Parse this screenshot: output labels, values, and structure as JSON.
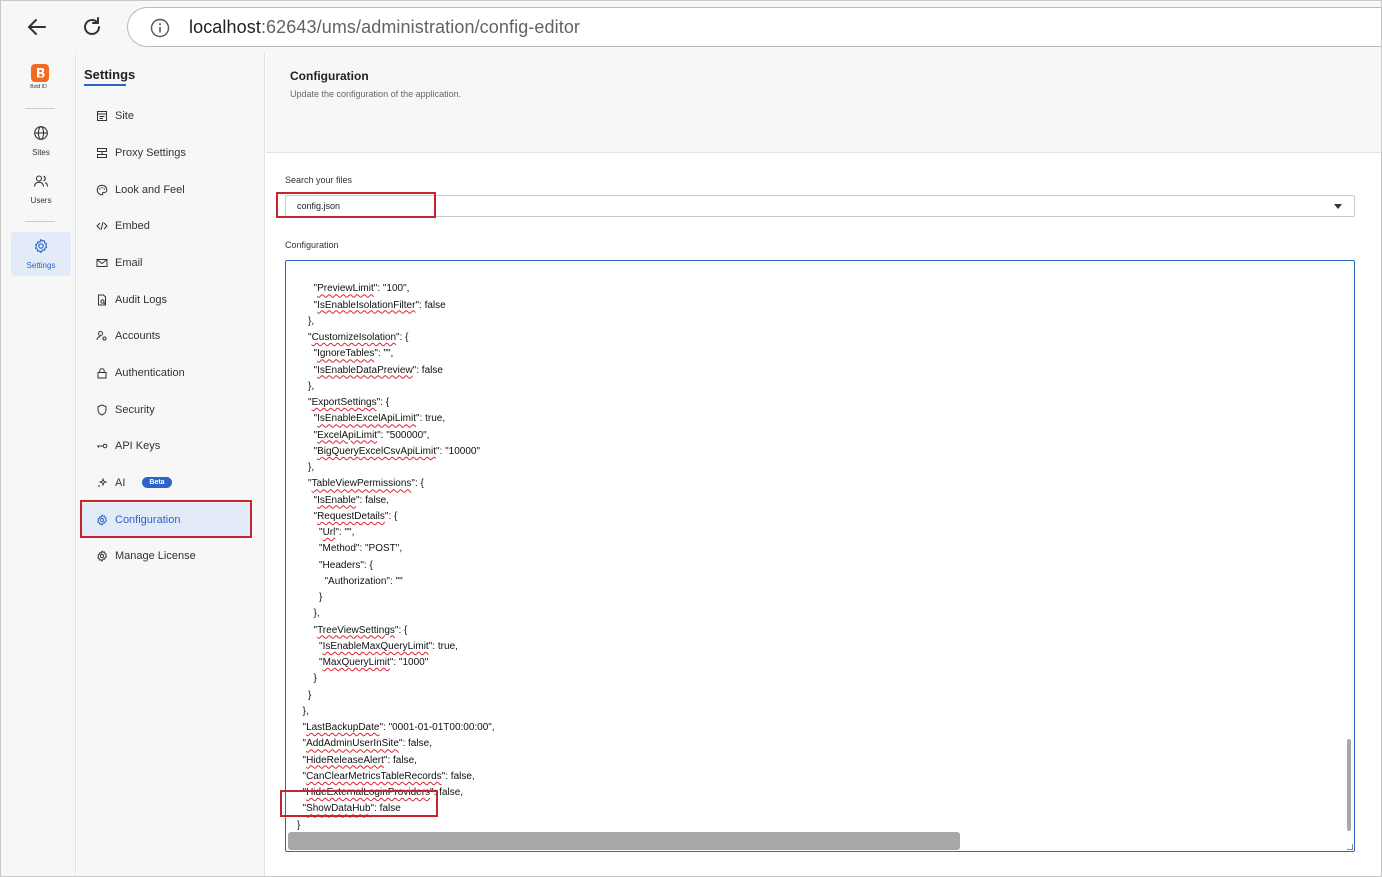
{
  "browser": {
    "url_host": "localhost",
    "url_rest": ":62643/ums/administration/config-editor"
  },
  "rail": {
    "logo_label": "Bold ID",
    "items": [
      {
        "label": "Sites",
        "icon": "globe-icon"
      },
      {
        "label": "Users",
        "icon": "users-icon"
      },
      {
        "label": "Settings",
        "icon": "gear-icon",
        "active": true
      }
    ]
  },
  "sidebar": {
    "title": "Settings",
    "items": [
      {
        "label": "Site",
        "icon": "site-icon"
      },
      {
        "label": "Proxy Settings",
        "icon": "proxy-icon"
      },
      {
        "label": "Look and Feel",
        "icon": "palette-icon"
      },
      {
        "label": "Embed",
        "icon": "code-icon"
      },
      {
        "label": "Email",
        "icon": "mail-icon"
      },
      {
        "label": "Audit Logs",
        "icon": "audit-log-icon"
      },
      {
        "label": "Accounts",
        "icon": "accounts-icon"
      },
      {
        "label": "Authentication",
        "icon": "lock-icon"
      },
      {
        "label": "Security",
        "icon": "shield-icon"
      },
      {
        "label": "API Keys",
        "icon": "key-icon"
      },
      {
        "label": "AI",
        "icon": "sparkle-icon",
        "badge": "Beta"
      },
      {
        "label": "Configuration",
        "icon": "gear-icon",
        "active": true
      },
      {
        "label": "Manage License",
        "icon": "license-gear-icon"
      }
    ]
  },
  "main": {
    "title": "Configuration",
    "subtitle": "Update the configuration of the application.",
    "search_label": "Search your files",
    "selected_file": "config.json",
    "config_label": "Configuration"
  },
  "editor": {
    "lines": [
      {
        "indent": 3,
        "text": ""
      },
      {
        "indent": 3,
        "key": "PreviewLimit",
        "rest": ": \"100\","
      },
      {
        "indent": 3,
        "key": "IsEnableIsolationFilter",
        "rest": ": false"
      },
      {
        "indent": 2,
        "text": "},"
      },
      {
        "indent": 2,
        "key": "CustomizeIsolation",
        "rest": ": {"
      },
      {
        "indent": 3,
        "key": "IgnoreTables",
        "rest": ": \"\","
      },
      {
        "indent": 3,
        "key": "IsEnableDataPreview",
        "rest": ": false"
      },
      {
        "indent": 2,
        "text": "},"
      },
      {
        "indent": 2,
        "key": "ExportSettings",
        "rest": ": {"
      },
      {
        "indent": 3,
        "key": "IsEnableExcelApiLimit",
        "rest": ": true,"
      },
      {
        "indent": 3,
        "key": "ExcelApiLimit",
        "rest": ": \"500000\","
      },
      {
        "indent": 3,
        "key": "BigQueryExcelCsvApiLimit",
        "rest": ": \"10000\""
      },
      {
        "indent": 2,
        "text": "},"
      },
      {
        "indent": 2,
        "key": "TableViewPermissions",
        "rest": ": {"
      },
      {
        "indent": 3,
        "key": "IsEnable",
        "rest": ": false,"
      },
      {
        "indent": 3,
        "key": "RequestDetails",
        "rest": ": {"
      },
      {
        "indent": 4,
        "key": "Url",
        "rest": ": \"\","
      },
      {
        "indent": 4,
        "text": "\"Method\": \"POST\","
      },
      {
        "indent": 4,
        "text": "\"Headers\": {"
      },
      {
        "indent": 5,
        "text": "\"Authorization\": \"\""
      },
      {
        "indent": 4,
        "text": "}"
      },
      {
        "indent": 3,
        "text": "},"
      },
      {
        "indent": 3,
        "key": "TreeViewSettings",
        "rest": ": {"
      },
      {
        "indent": 4,
        "key": "IsEnableMaxQueryLimit",
        "rest": ": true,"
      },
      {
        "indent": 4,
        "key": "MaxQueryLimit",
        "rest": ": \"1000\""
      },
      {
        "indent": 3,
        "text": "}"
      },
      {
        "indent": 2,
        "text": "}"
      },
      {
        "indent": 1,
        "text": "},"
      },
      {
        "indent": 1,
        "key": "LastBackupDate",
        "rest": ": \"0001-01-01T00:00:00\","
      },
      {
        "indent": 1,
        "key": "AddAdminUserInSite",
        "rest": ": false,"
      },
      {
        "indent": 1,
        "key": "HideReleaseAlert",
        "rest": ": false,"
      },
      {
        "indent": 1,
        "key": "CanClearMetricsTableRecords",
        "rest": ": false,"
      },
      {
        "indent": 1,
        "key": "HideExternalLoginProviders",
        "rest": ": false,"
      },
      {
        "indent": 1,
        "key": "ShowDataHub",
        "rest": ": false"
      },
      {
        "indent": 0,
        "text": "}"
      }
    ]
  },
  "colors": {
    "accent": "#2c63c8",
    "highlight": "#c4262e",
    "brand": "#f26a21"
  }
}
